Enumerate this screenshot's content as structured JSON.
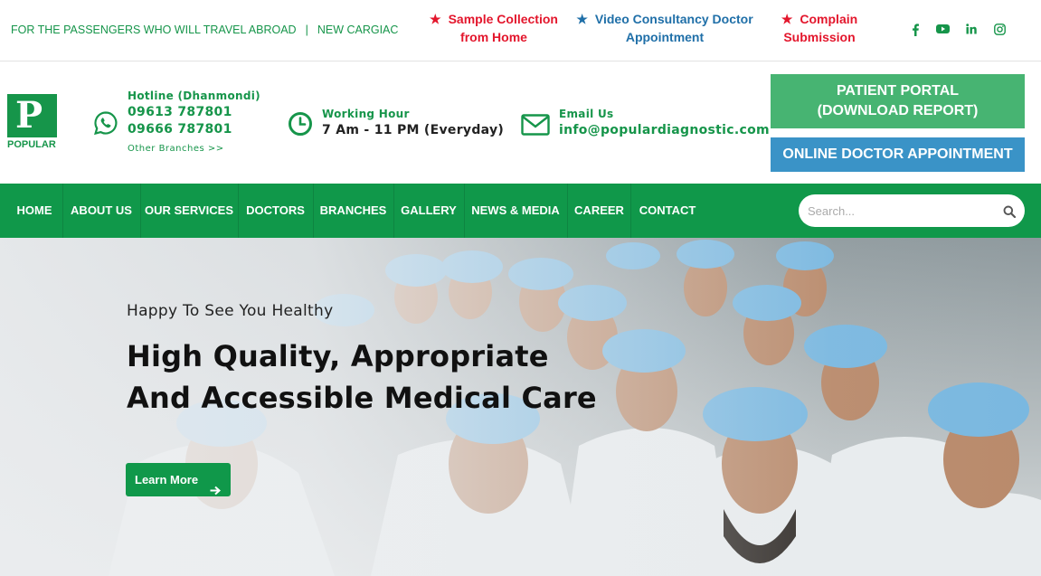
{
  "topbar": {
    "ticker_1": "FOR THE PASSENGERS WHO WILL TRAVEL ABROAD",
    "ticker_sep": "|",
    "ticker_2": "NEW CARGIAC MRI M",
    "quick_1": {
      "line1": "Sample Collection",
      "line2": "from Home",
      "star_color": "#e3162c"
    },
    "quick_2": {
      "line1": "Video Consultancy Doctor",
      "line2": "Appointment",
      "star_color": "#1f6fa8"
    },
    "quick_3": {
      "line1": "Complain",
      "line2": "Submission",
      "star_color": "#e3162c"
    },
    "social": [
      "facebook-icon",
      "youtube-icon",
      "linkedin-icon",
      "instagram-icon"
    ]
  },
  "header": {
    "logo_letter": "P",
    "logo_text": "POPULAR",
    "hotline_label": "Hotline (Dhanmondi)",
    "hotline_1": "09613 787801",
    "hotline_2": "09666 787801",
    "other_branches": "Other Branches >>",
    "hours_label": "Working Hour",
    "hours_value": "7 Am - 11 PM (Everyday)",
    "email_label": "Email Us",
    "email_value": "info@populardiagnostic.com",
    "portal_line1": "PATIENT PORTAL",
    "portal_line2": "(DOWNLOAD REPORT)",
    "appointment": "ONLINE DOCTOR APPOINTMENT"
  },
  "nav": {
    "items": [
      "HOME",
      "ABOUT US",
      "OUR SERVICES",
      "DOCTORS",
      "BRANCHES",
      "GALLERY",
      "NEWS & MEDIA",
      "CAREER",
      "CONTACT"
    ],
    "search_placeholder": "Search..."
  },
  "hero": {
    "tagline": "Happy To See You Healthy",
    "title_line1": "High Quality, Appropriate",
    "title_line2": "And Accessible Medical Care",
    "cta": "Learn More"
  },
  "colors": {
    "brand_green": "#10984a",
    "portal_green": "#47b472",
    "appointment_blue": "#3a93c7",
    "alert_red": "#e3162c"
  }
}
